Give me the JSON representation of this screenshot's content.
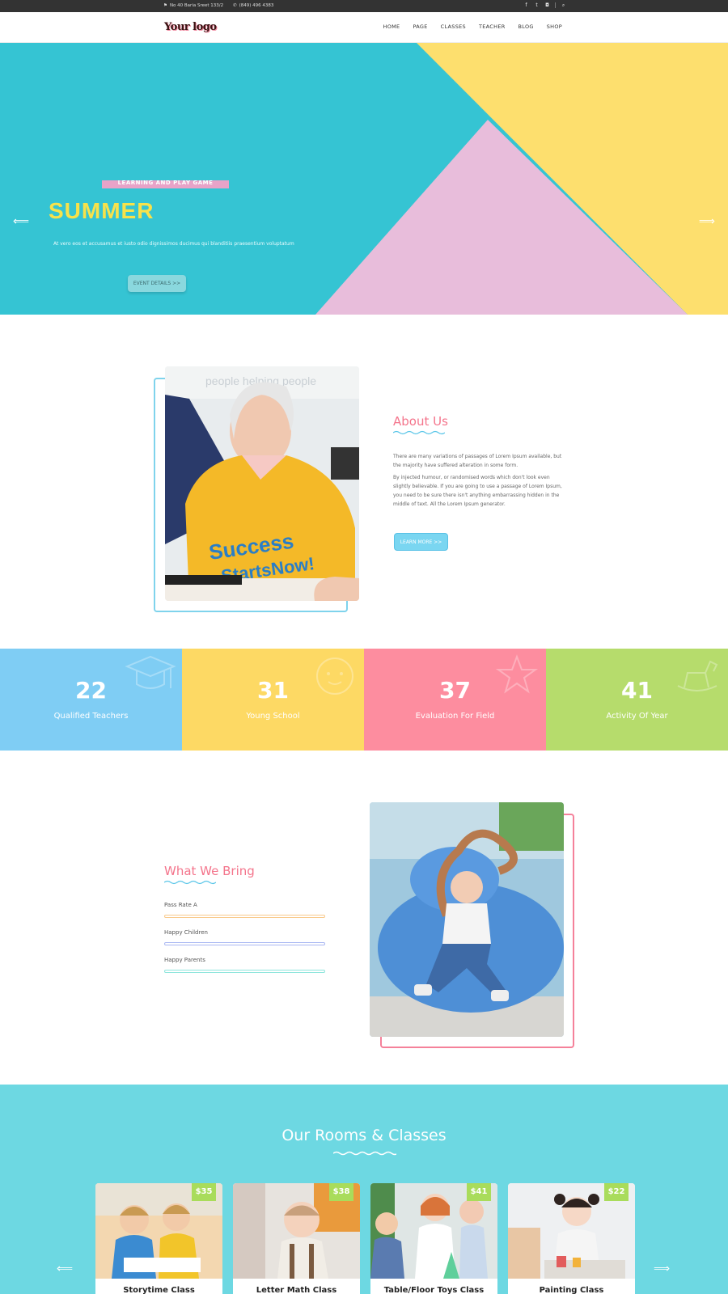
{
  "topbar": {
    "address": "No 40 Baria Sreet 133/2",
    "phone": "(849) 496 4383",
    "social": [
      "facebook-icon",
      "twitter-icon",
      "instagram-icon"
    ],
    "search_icon": "search-icon"
  },
  "header": {
    "logo": "Your logo",
    "nav": [
      "HOME",
      "PAGE",
      "CLASSES",
      "TEACHER",
      "BLOG",
      "SHOP"
    ]
  },
  "hero": {
    "tag": "LEARNING AND PLAY GAME",
    "title": "SUMMER",
    "description": "At vero eos et accusamus et iusto odio dignissimos ducimus qui blanditiis praesentium voluptatum",
    "button": "EVENT DETAILS  >>",
    "prev": "⟸",
    "next": "⟹",
    "colors": {
      "teal": "#35c4d3",
      "yellow": "#fddf6e",
      "pink": "#e8bddb"
    }
  },
  "about": {
    "title": "About Us",
    "p1": "There are many variations of passages of Lorem Ipsum available, but the majority have suffered alteration in some form.",
    "p2": "By injected humour, or randomised words which don't look even slightly believable. If you are going to use a passage of Lorem Ipsum, you need to be sure there isn't anything embarrassing hidden in the middle of text. All the Lorem Ipsum generator.",
    "button": "LEARN MORE  >>",
    "photo_shirt_text": "Success Starts Now!",
    "photo_background_text": "people helping people"
  },
  "stats": [
    {
      "num": "22",
      "label": "Qualified Teachers",
      "color": "#7fcdf4"
    },
    {
      "num": "31",
      "label": "Young School",
      "color": "#fdd964"
    },
    {
      "num": "37",
      "label": "Evaluation For Field",
      "color": "#fd8d9f"
    },
    {
      "num": "41",
      "label": "Activity Of Year",
      "color": "#b6dc6c"
    }
  ],
  "bring": {
    "title": "What We Bring",
    "bars": [
      {
        "label": "Pass Rate A",
        "color": "#f9c98a"
      },
      {
        "label": "Happy Children",
        "color": "#a9b7f2"
      },
      {
        "label": "Happy Parents",
        "color": "#8de5dc"
      }
    ]
  },
  "classes": {
    "title": "Our Rooms & Classes",
    "prev": "⟸",
    "next": "⟹",
    "cards": [
      {
        "price": "$35",
        "name": "Storytime Class"
      },
      {
        "price": "$38",
        "name": "Letter Math Class"
      },
      {
        "price": "$41",
        "name": "Table/Floor Toys Class"
      },
      {
        "price": "$22",
        "name": "Painting Class"
      }
    ]
  }
}
